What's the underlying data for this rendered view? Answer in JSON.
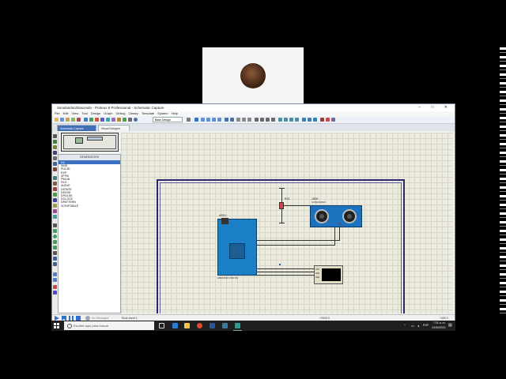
{
  "window": {
    "title": "SimulandoUltrasonido - Proteus 8 Professional - Schematic Capture",
    "controls": "–  □  ✕"
  },
  "menu": [
    "File",
    "Edit",
    "View",
    "Tool",
    "Design",
    "Graph",
    "Debug",
    "Library",
    "Template",
    "System",
    "Help"
  ],
  "toolbar": {
    "design_select": "Base Design"
  },
  "tabs": [
    {
      "label": "Schematic Capture"
    },
    {
      "label": "Visual Designer"
    }
  ],
  "device_panel": {
    "header": "GENERATORS",
    "items": [
      "DC",
      "SINE",
      "PULSE",
      "EXP",
      "SFFM",
      "PWLIN",
      "FILE",
      "AUDIO",
      "DSTATE",
      "DEDGE",
      "DPULSE",
      "DCLOCK",
      "DPATTERN",
      "SCRIPTABLE"
    ]
  },
  "schematic": {
    "rv_label": "RV1",
    "arduino_label": "ARD1",
    "arduino_sublabel": "ARDUINO UNO R3",
    "sensor_label": "U500",
    "sensor_sublabel": "ULTRASONIC",
    "lcd_pins": [
      "VSS",
      "VDD",
      "VEE"
    ]
  },
  "status": {
    "messages": "No Messages",
    "sheet": "Root sheet 1",
    "coord_x": "+2000.0",
    "coord_y": "+400.0"
  },
  "taskbar": {
    "search_placeholder": "Escribe aquí para buscar",
    "time": "7:31 a. m.",
    "date": "24/09/2020",
    "language": "ESP"
  },
  "colors": {
    "arduino": "#1a7fc4",
    "sensor": "#1d72bf",
    "sheet_border": "#28286a",
    "tab_active": "#3f6fb5"
  }
}
